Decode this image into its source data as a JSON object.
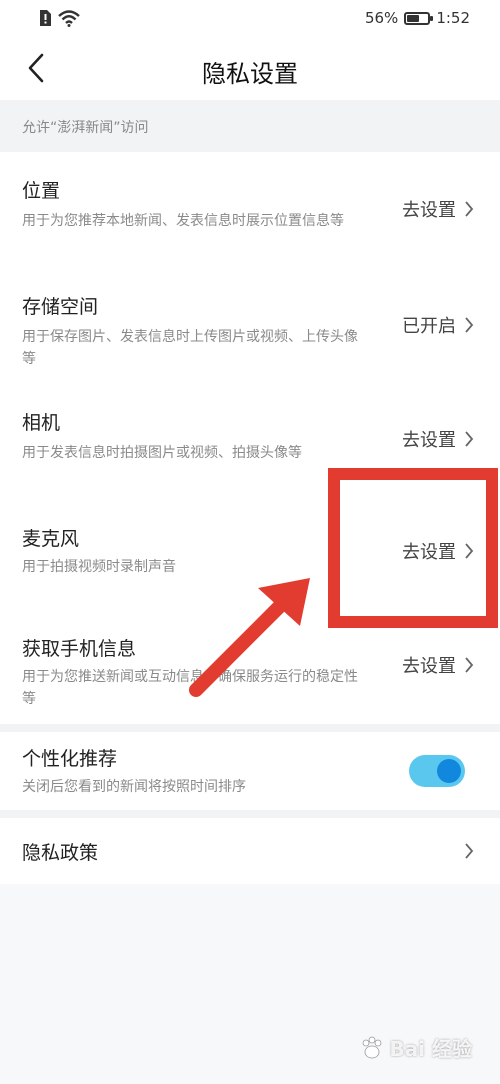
{
  "status_bar": {
    "battery": "56%",
    "battery_level": 0.56,
    "time": "1:52"
  },
  "nav": {
    "title": "隐私设置"
  },
  "section": {
    "label": "允许“澎湃新闻”访问"
  },
  "permissions": [
    {
      "title": "位置",
      "desc": "用于为您推荐本地新闻、发表信息时展示位置信息等",
      "action": "去设置"
    },
    {
      "title": "存储空间",
      "desc": "用于保存图片、发表信息时上传图片或视频、上传头像等",
      "action": "已开启"
    },
    {
      "title": "相机",
      "desc": "用于发表信息时拍摄图片或视频、拍摄头像等",
      "action": "去设置"
    },
    {
      "title": "麦克风",
      "desc": "用于拍摄视频时录制声音",
      "action": "去设置"
    },
    {
      "title": "获取手机信息",
      "desc": "用于为您推送新闻或互动信息、确保服务运行的稳定性等",
      "action": "去设置"
    }
  ],
  "personalization": {
    "title": "个性化推荐",
    "desc": "关闭后您看到的新闻将按照时间排序",
    "enabled": true
  },
  "policy": {
    "title": "隐私政策"
  },
  "watermark": {
    "text": "Bai 经验"
  },
  "colors": {
    "accent": "#1188dd",
    "toggle_track": "#5ac8ee",
    "annotation": "#e23b30"
  }
}
